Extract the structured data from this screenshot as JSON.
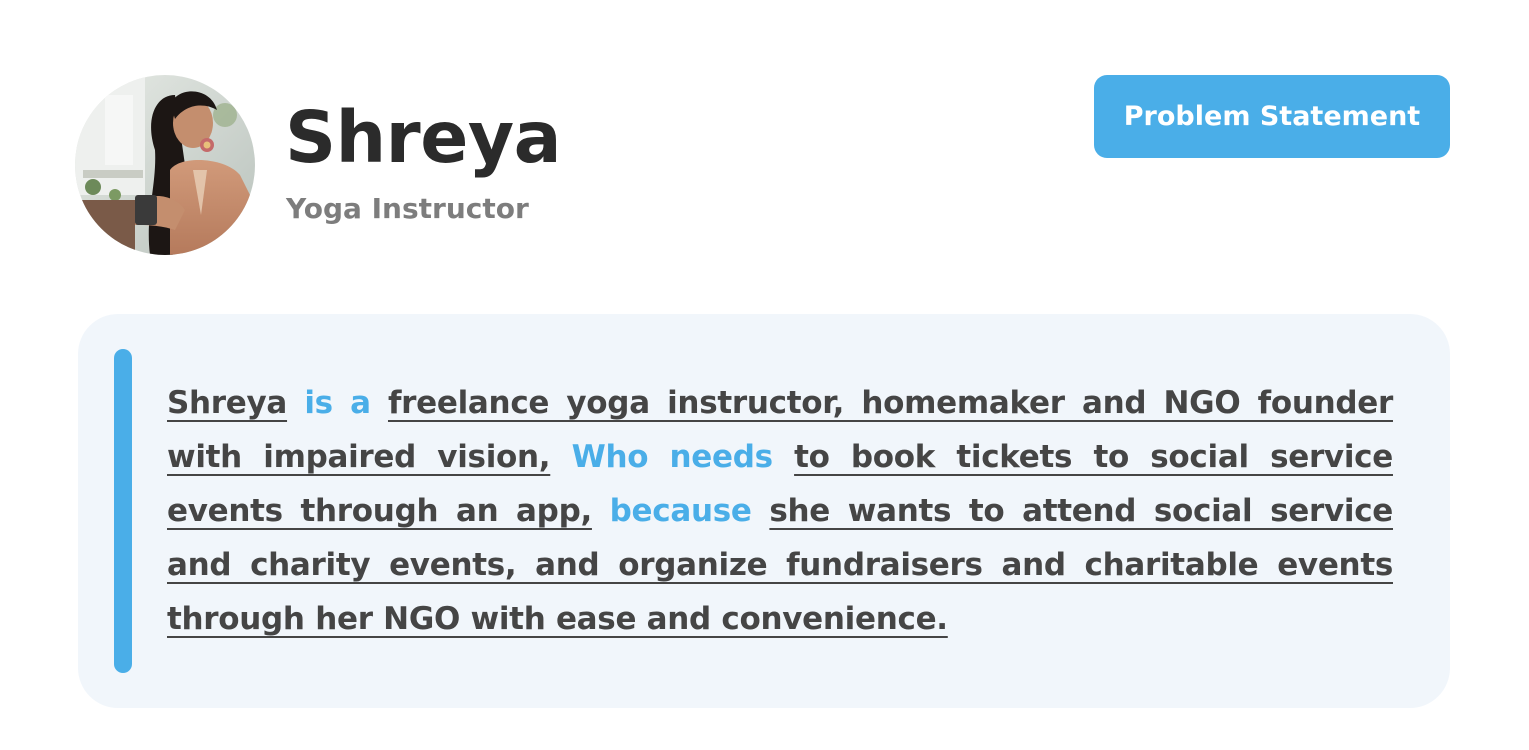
{
  "persona": {
    "name": "Shreya",
    "role": "Yoga Instructor"
  },
  "section_button": {
    "label": "Problem Statement"
  },
  "statement": {
    "subject": "Shreya",
    "kw_is_a": "is a",
    "description": "freelance yoga instructor, homemaker and NGO founder with impaired vision,",
    "kw_who_needs": "Who needs",
    "need": "to book tickets to social service events through an app,",
    "kw_because": "because",
    "reason": "she wants to attend social service and charity events, and organize fundraisers and charitable events through her NGO with ease and convenience."
  },
  "colors": {
    "accent": "#4aaee8",
    "title_text": "#2b2b2b",
    "subtitle_text": "#7d7d7d",
    "body_text": "#454545",
    "card_background": "#f1f6fb"
  },
  "icons": {
    "avatar": "persona-photo"
  }
}
